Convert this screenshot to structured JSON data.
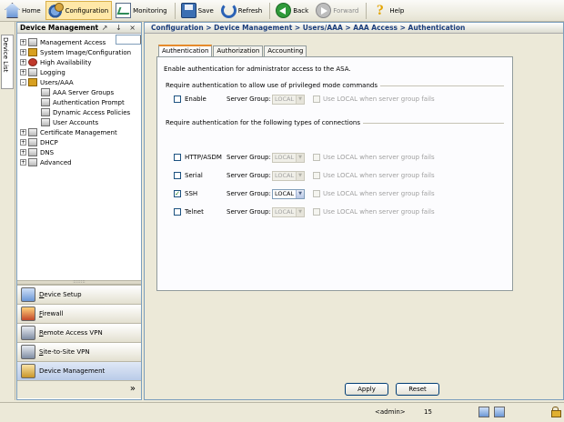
{
  "toolbar": {
    "buttons": [
      {
        "label": "Home",
        "icon": "home-icon"
      },
      {
        "label": "Configuration",
        "icon": "configuration-icon",
        "active": true
      },
      {
        "label": "Monitoring",
        "icon": "monitoring-icon"
      },
      {
        "label": "Save",
        "icon": "save-icon"
      },
      {
        "label": "Refresh",
        "icon": "refresh-icon"
      },
      {
        "label": "Back",
        "icon": "back-icon"
      },
      {
        "label": "Forward",
        "icon": "forward-icon",
        "disabled": true
      },
      {
        "label": "Help",
        "icon": "help-icon"
      }
    ]
  },
  "side_tab": {
    "label": "Device List"
  },
  "panel": {
    "title": "Device Management",
    "controls": "↗ ↓ ×",
    "tree": [
      {
        "label": "Management Access",
        "level": 0,
        "expander": "+"
      },
      {
        "label": "System Image/Configuration",
        "level": 0,
        "expander": "+"
      },
      {
        "label": "High Availability",
        "level": 0,
        "expander": "+"
      },
      {
        "label": "Logging",
        "level": 0,
        "expander": "+"
      },
      {
        "label": "Users/AAA",
        "level": 0,
        "expander": "-"
      },
      {
        "label": "AAA Server Groups",
        "level": 1
      },
      {
        "label": "Authentication Prompt",
        "level": 1
      },
      {
        "label": "AAA Access",
        "level": 1,
        "selected": true
      },
      {
        "label": "Dynamic Access Policies",
        "level": 1
      },
      {
        "label": "User Accounts",
        "level": 1
      },
      {
        "label": "Certificate Management",
        "level": 0,
        "expander": "+"
      },
      {
        "label": "DHCP",
        "level": 0,
        "expander": "+"
      },
      {
        "label": "DNS",
        "level": 0,
        "expander": "+"
      },
      {
        "label": "Advanced",
        "level": 0,
        "expander": "+"
      }
    ],
    "grip": "::::::::",
    "nav": [
      {
        "label": "Device Setup",
        "underline": "D",
        "rest": "evice Setup"
      },
      {
        "label": "Firewall",
        "underline": "F",
        "rest": "irewall"
      },
      {
        "label": "Remote Access VPN",
        "underline": "R",
        "rest": "emote Access VPN"
      },
      {
        "label": "Site-to-Site VPN",
        "underline": "S",
        "rest": "ite-to-Site VPN"
      },
      {
        "label": "Device Management",
        "underline": "",
        "rest": "Device Management",
        "active": true
      }
    ],
    "more": "»"
  },
  "content": {
    "breadcrumb": "Configuration > Device Management > Users/AAA > AAA Access > Authentication",
    "tabs": [
      "Authentication",
      "Authorization",
      "Accounting"
    ],
    "active_tab": "Authentication",
    "intro": "Enable authentication for administrator access to the ASA.",
    "group1_title": "Require authentication to allow use of privileged mode commands",
    "group2_title": "Require authentication for the following types of connections",
    "server_group_label": "Server Group:",
    "use_local_label": "Use LOCAL when server group fails",
    "rows": [
      {
        "name": "Enable",
        "checked": false,
        "server_group": "LOCAL",
        "enabled": false
      },
      {
        "name": "HTTP/ASDM",
        "checked": false,
        "server_group": "LOCAL",
        "enabled": false
      },
      {
        "name": "Serial",
        "checked": false,
        "server_group": "LOCAL",
        "enabled": false
      },
      {
        "name": "SSH",
        "checked": true,
        "server_group": "LOCAL",
        "enabled": true
      },
      {
        "name": "Telnet",
        "checked": false,
        "server_group": "LOCAL",
        "enabled": false
      }
    ],
    "apply_label": "Apply",
    "reset_label": "Reset"
  },
  "status": {
    "user": "<admin>",
    "count": "15"
  }
}
